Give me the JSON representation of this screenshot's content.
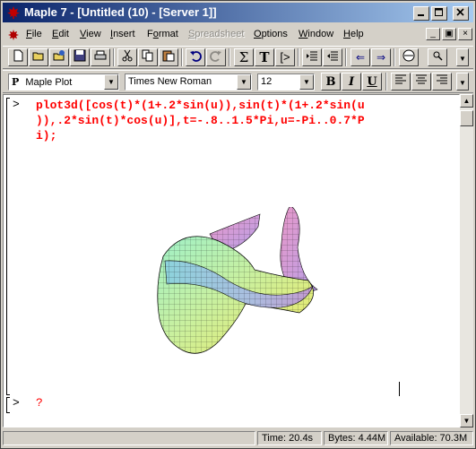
{
  "window": {
    "title": "Maple 7  - [Untitled (10) - [Server 1]]"
  },
  "menu": {
    "items": [
      {
        "label": "File",
        "underline": "F"
      },
      {
        "label": "Edit",
        "underline": "E"
      },
      {
        "label": "View",
        "underline": "V"
      },
      {
        "label": "Insert",
        "underline": "I"
      },
      {
        "label": "Format",
        "underline": "o"
      },
      {
        "label": "Spreadsheet",
        "underline": "S",
        "disabled": true
      },
      {
        "label": "Options",
        "underline": "O"
      },
      {
        "label": "Window",
        "underline": "W"
      },
      {
        "label": "Help",
        "underline": "H"
      }
    ]
  },
  "format_toolbar": {
    "style_value": "Maple Plot",
    "style_prefix": "P",
    "font_value": "Times New Roman",
    "size_value": "12",
    "bold_label": "B",
    "italic_label": "I",
    "underline_label": "U"
  },
  "worksheet": {
    "prompt": ">",
    "command_lines": [
      "plot3d([cos(t)*(1+.2*sin(u)),sin(t)*(1+.2*sin(u",
      ")),.2*sin(t)*cos(u)],t=-.8..1.5*Pi,u=-Pi..0.7*P",
      "i);"
    ],
    "next_prompt": ">",
    "next_input": "?"
  },
  "status": {
    "time": "Time:  20.4s",
    "bytes": "Bytes: 4.44M",
    "available": "Available: 70.3M"
  },
  "colors": {
    "title_start": "#0a246a",
    "title_end": "#a6caf0",
    "command_text": "#ff0000",
    "chrome": "#d4d0c8"
  }
}
